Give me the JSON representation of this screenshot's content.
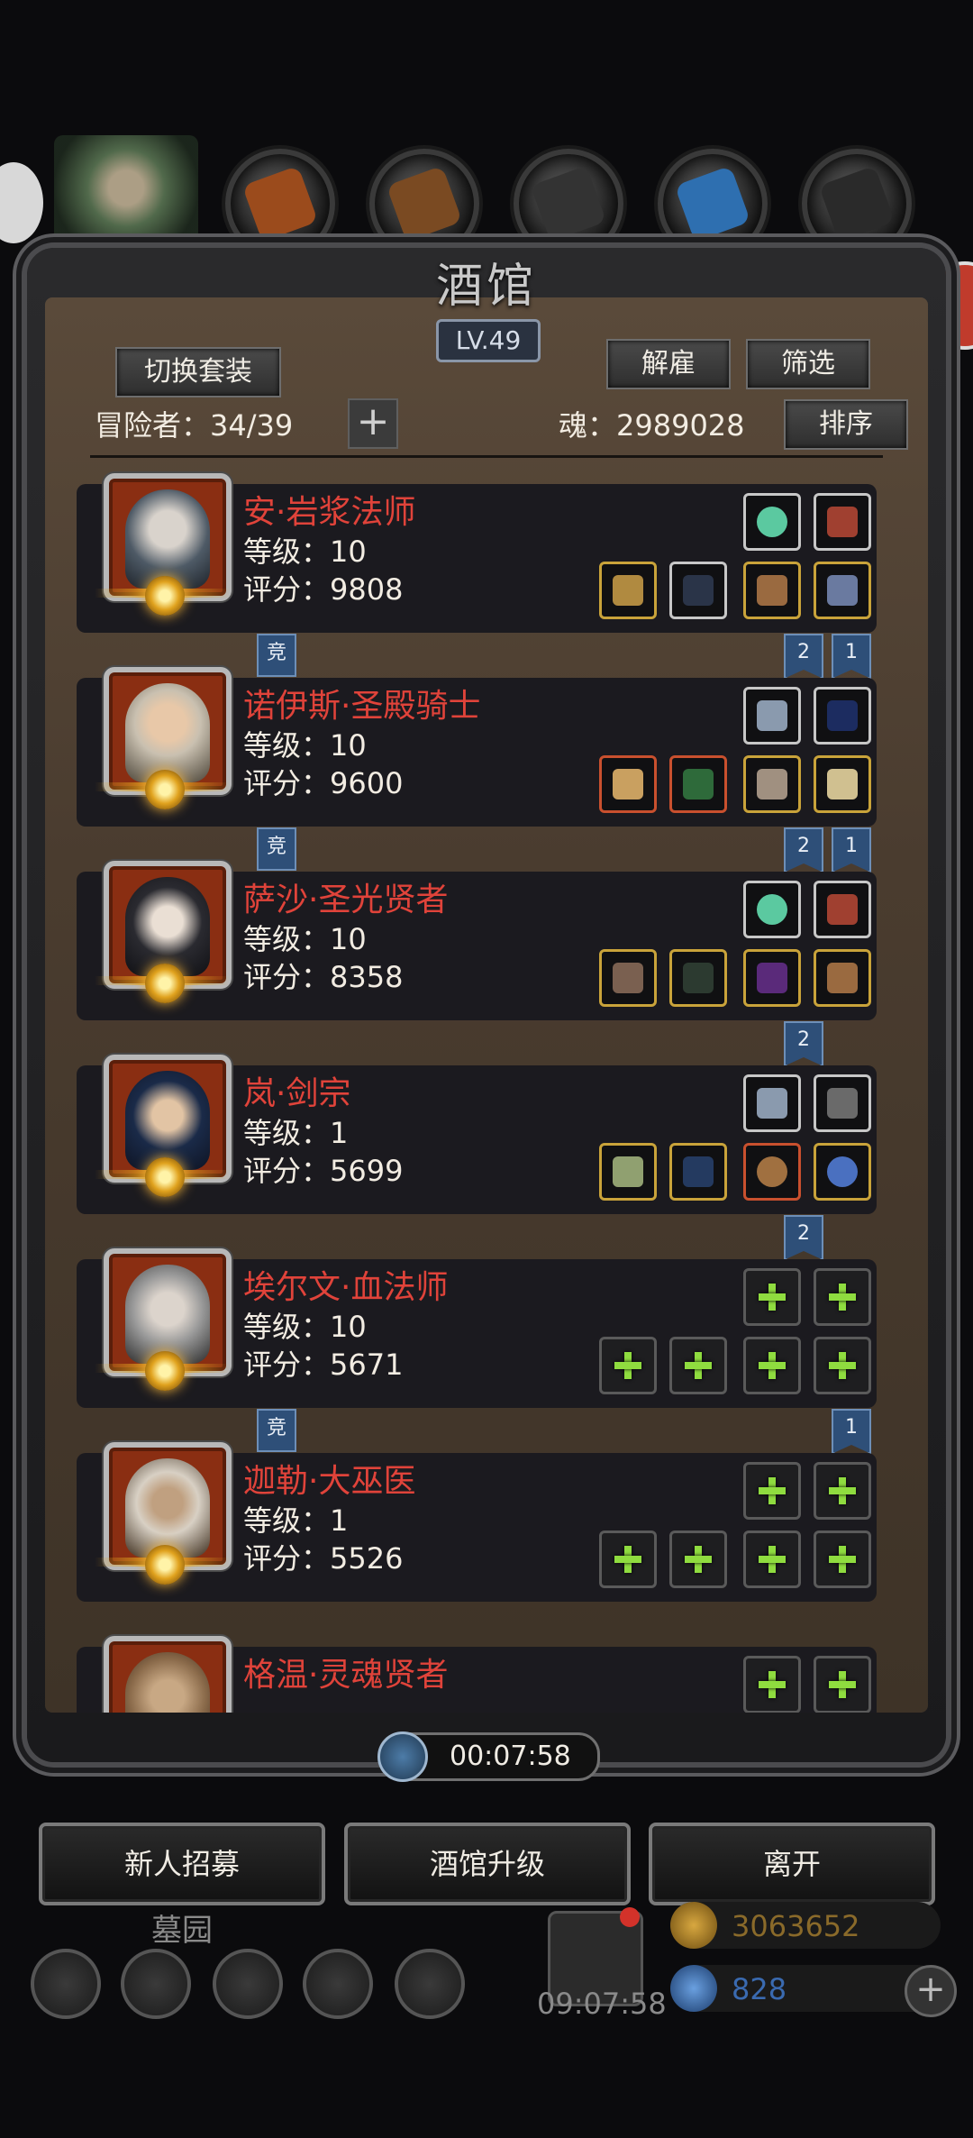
{
  "window": {
    "title": "酒馆",
    "level": "LV.49"
  },
  "header": {
    "switch_outfit": "切换套装",
    "dismiss": "解雇",
    "filter": "筛选",
    "sort": "排序",
    "adventurers_label": "冒险者：34/39",
    "soul_label": "魂：2989028"
  },
  "heroes": [
    {
      "name": "安·岩浆法师",
      "level": "等级：10",
      "score": "评分：9808"
    },
    {
      "name": "诺伊斯·圣殿骑士",
      "level": "等级：10",
      "score": "评分：9600"
    },
    {
      "name": "萨沙·圣光贤者",
      "level": "等级：10",
      "score": "评分：8358"
    },
    {
      "name": "岚·剑宗",
      "level": "等级：1",
      "score": "评分：5699"
    },
    {
      "name": "埃尔文·血法师",
      "level": "等级：10",
      "score": "评分：5671"
    },
    {
      "name": "迦勒·大巫医",
      "level": "等级：1",
      "score": "评分：5526"
    },
    {
      "name": "格温·灵魂贤者",
      "level": "",
      "score": ""
    }
  ],
  "tags": {
    "arena": "竞",
    "two": "2",
    "one": "1"
  },
  "timer": "00:07:58",
  "buttons": {
    "recruit": "新人招募",
    "upgrade": "酒馆升级",
    "leave": "离开"
  },
  "background": {
    "graveyard": "墓园",
    "gift_timer": "09:07:58",
    "gold": "3063652",
    "gems": "828"
  },
  "colors": {
    "hero_name": "#e0433a",
    "gold_text": "#8a6a2a",
    "gem_text": "#3a6ab0"
  }
}
